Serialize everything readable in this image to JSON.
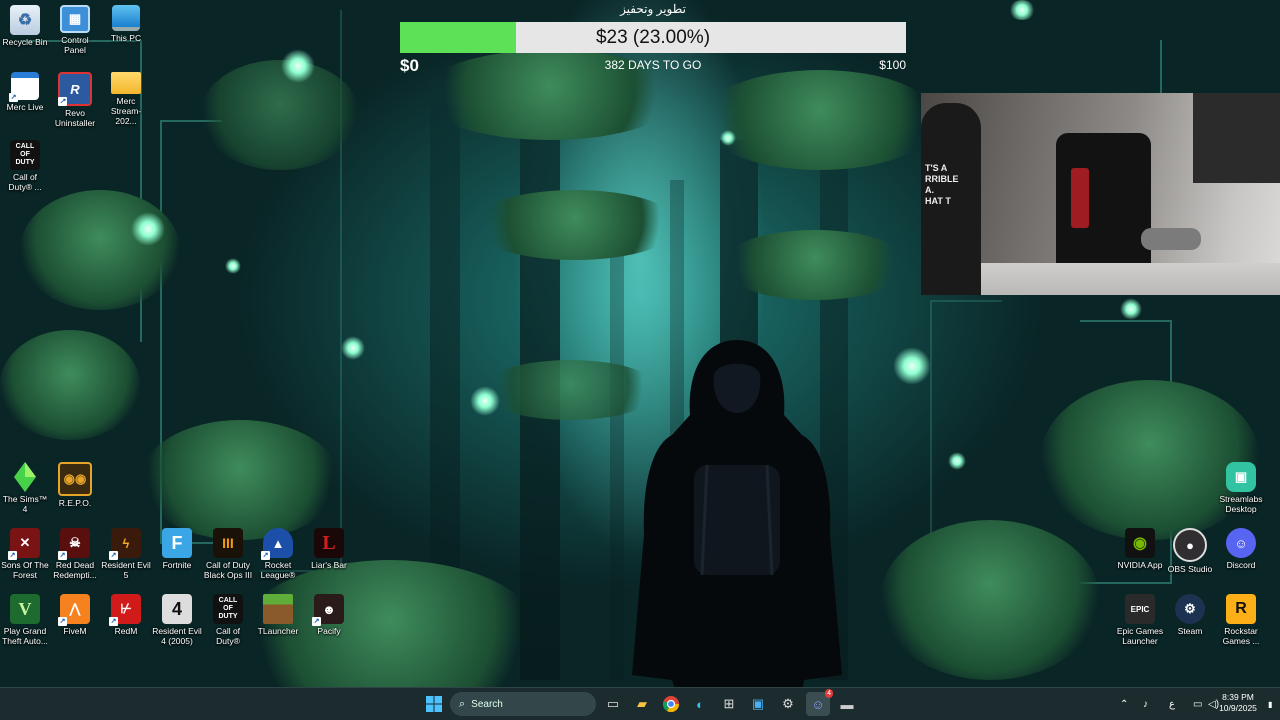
{
  "donation_goal": {
    "title": "تطوير وتحفيز",
    "amount_text": "$23 (23.00%)",
    "progress_percent": 23,
    "min_label": "$0",
    "days_left_text": "382 DAYS TO GO",
    "max_label": "$100",
    "fill_color": "#5ce157",
    "track_color": "#e6e6e6"
  },
  "webcam": {
    "shirt_text": "T'S A\nRRIBLE\nA.\nHAT T"
  },
  "desktop_icons": {
    "recycle_bin": {
      "label": "Recycle Bin",
      "icon": "recycle-bin-icon"
    },
    "control_panel": {
      "label": "Control Panel",
      "icon": "control-panel-icon"
    },
    "this_pc": {
      "label": "This PC",
      "icon": "monitor-icon"
    },
    "merc_live": {
      "label": "Merc Live",
      "icon": "window-icon"
    },
    "revo_uninstaller": {
      "label": "Revo Uninstaller",
      "icon": "revo-icon"
    },
    "merc_stream": {
      "label": "Merc Stream-202...",
      "icon": "folder-icon"
    },
    "cod_top": {
      "label": "Call of Duty® ...",
      "icon": "call-of-duty-icon",
      "glyph": "CALL OF DUTY"
    },
    "sims4": {
      "label": "The Sims™ 4",
      "icon": "plumbob-icon"
    },
    "repo": {
      "label": "R.E.P.O.",
      "icon": "repo-robot-icon"
    },
    "sons_forest": {
      "label": "Sons Of The Forest",
      "icon": "sons-of-the-forest-icon"
    },
    "rdr": {
      "label": "Red Dead Redempti...",
      "icon": "red-dead-icon"
    },
    "re5": {
      "label": "Resident Evil 5",
      "icon": "resident-evil-icon"
    },
    "fortnite": {
      "label": "Fortnite",
      "icon": "fortnite-icon",
      "glyph": "F"
    },
    "cod_bo3": {
      "label": "Call of Duty Black Ops III",
      "icon": "black-ops-icon",
      "glyph": "III"
    },
    "rocket_league": {
      "label": "Rocket League®",
      "icon": "rocket-league-icon"
    },
    "liars_bar": {
      "label": "Liar's Bar",
      "icon": "liars-bar-icon",
      "glyph": "L"
    },
    "gta": {
      "label": "Play Grand Theft Auto...",
      "icon": "gta-icon",
      "glyph": "V"
    },
    "fivem": {
      "label": "FiveM",
      "icon": "fivem-icon"
    },
    "redm": {
      "label": "RedM",
      "icon": "redm-icon"
    },
    "re4": {
      "label": "Resident Evil 4 (2005)",
      "icon": "resident-evil-4-icon",
      "glyph": "4"
    },
    "cod_bottom": {
      "label": "Call of Duty®",
      "icon": "call-of-duty-icon",
      "glyph": "CALL OF DUTY"
    },
    "tlauncher": {
      "label": "TLauncher",
      "icon": "grass-block-icon"
    },
    "pacify": {
      "label": "Pacify",
      "icon": "pacify-icon"
    },
    "streamlabs": {
      "label": "Streamlabs Desktop",
      "icon": "streamlabs-icon"
    },
    "nvidia": {
      "label": "NVIDIA App",
      "icon": "nvidia-icon"
    },
    "obs": {
      "label": "OBS Studio",
      "icon": "obs-icon"
    },
    "discord": {
      "label": "Discord",
      "icon": "discord-icon"
    },
    "epic": {
      "label": "Epic Games Launcher",
      "icon": "epic-games-icon",
      "glyph": "EPIC"
    },
    "steam": {
      "label": "Steam",
      "icon": "steam-icon"
    },
    "rockstar": {
      "label": "Rockstar Games ...",
      "icon": "rockstar-icon",
      "glyph": "R"
    }
  },
  "taskbar": {
    "search_placeholder": "Search",
    "discord_badge": "4",
    "input_language": "ع",
    "time": "8:39 PM",
    "date": "10/9/2025"
  }
}
